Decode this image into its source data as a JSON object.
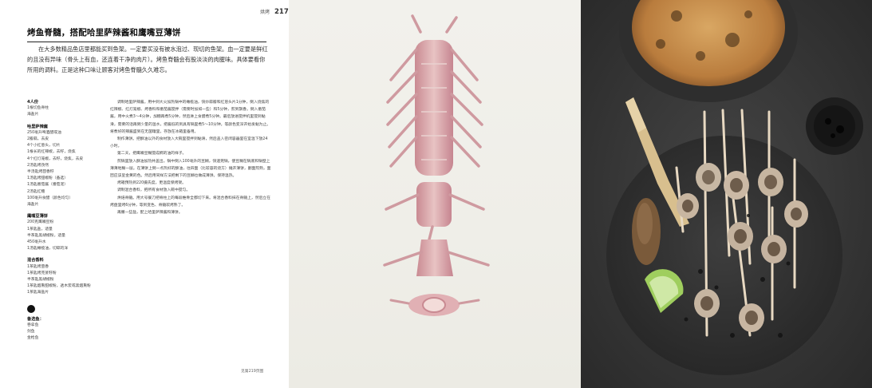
{
  "header": {
    "section": "烘烤",
    "page_number": "217"
  },
  "title": "烤鱼脊髓，搭配哈里萨辣酱和鹰嘴豆薄饼",
  "intro": "在大多数精品鱼店里都能买到鱼架。一定要买没有被水泡过、现切的鱼架。血一定要是鲜红的且没有异味（骨头上有血，还连着干净的肉片）。烤鱼脊髓会有股淡淡的肉腥味。具体要看你所用的调料。正是这种口味让顾客对烤鱼脊髓久久难忘。",
  "sidebar": {
    "serves": {
      "heading": "4人份",
      "items": [
        "1根切鱼脊柱",
        "海盐片"
      ]
    },
    "harissa": {
      "heading": "哈里萨辣酱",
      "items": [
        "250毫升啤酒醋或油",
        "2瓣蒜，去皮",
        "4个小红葱头，切片",
        "1根长的红辣椒，去籽，烧焦",
        "4个红灯笼椒，去籽，烧焦，去皮",
        "2汤匙烤孜然",
        "半汤匙烤茴香籽",
        "1汤匙烤甜椒粉（备选）",
        "1汤匙番茄酱（番茄泥）",
        "2汤匙红糖",
        "100毫升食醋（颜色均匀）",
        "海盐片"
      ]
    },
    "pancake": {
      "heading": "鹰嘴豆薄饼",
      "items": [
        "200克鹰嘴豆粉",
        "1茶匙盐，适量",
        "半茶匙黑胡椒粉，适量",
        "450毫升水",
        "1汤匙橄榄油，切碎的洋"
      ]
    },
    "spices": {
      "heading": "混合香料",
      "items": [
        "1茶匙烤茴香",
        "1茶匙烤芫荽籽粉",
        "半茶匙黑胡椒粉",
        "1茶匙烟熏甜椒粉，透木炭或黑烟熏粉",
        "1茶匙海盐片"
      ]
    },
    "options": {
      "heading": "备选鱼：",
      "items": [
        "吞拿鱼",
        "剑鱼",
        "金枪鱼"
      ]
    }
  },
  "method": [
    "调制哈里萨辣酱。用中到大火加热锅中的橄榄油，快炒蒜瓣和红葱头片1分钟，倒入烧焦的红辣椒、红灯笼椒、烤香料和番茄酱搅拌（需要时加如一些）和5分钟，煎到飘香。倒入番茄酱，用中火煮3～4分钟，加糖再煮5分钟，然后淋上食醋煮5分钟。最后放进搅拌机里搅到黏滑，需要的话再倒少量的温水，把酱低的到具有锅里煮5～10分钟，等颜色变深开始发黏为止。将煮好的辣酱盛到在无菌罐里，存放在冰箱里备用。",
    "制作薄饼。把酥油以外的食材放入大碗里搅拌到黏滑，然后盖入密闭容器里在室温下放24小时。",
    "第二天，把鹰嘴豆糊搅成稠的油的样子。",
    "煎锅里放入酥油加热并盖出。锅中倒入100毫升的豆糊，快速晃锅，使豆糊在锅底和锅壁上薄薄地糊一层。在薄饼上倒一点热好的酥油，往四面（比较容的烧方）摊开薄饼，翻面煎熟，面团应该呈金黄的色。然后用同样方法把剩下的豆糊也做成薄饼。保持温热。",
    "烤箱预热到220摄氏度，更温度保烤架。",
    "调制混合香料，把所有食材放入碗中搅匀。",
    "烘焙脊髓。用大号餐刀把脊柱上的每段椎骨全都切下来。将混合香料抹在脊髓上，然后立在烤盘里烤6分钟，等到变色、脊髓软烤熟了。",
    "再撒一些盐，配上哈里萨辣酱和薄饼。"
  ],
  "footnote": "见第219页图",
  "colors": {
    "text": "#333333",
    "title_rule": "#222222",
    "slate": "#2f2f2f",
    "backdrop": "#f0efe9"
  }
}
